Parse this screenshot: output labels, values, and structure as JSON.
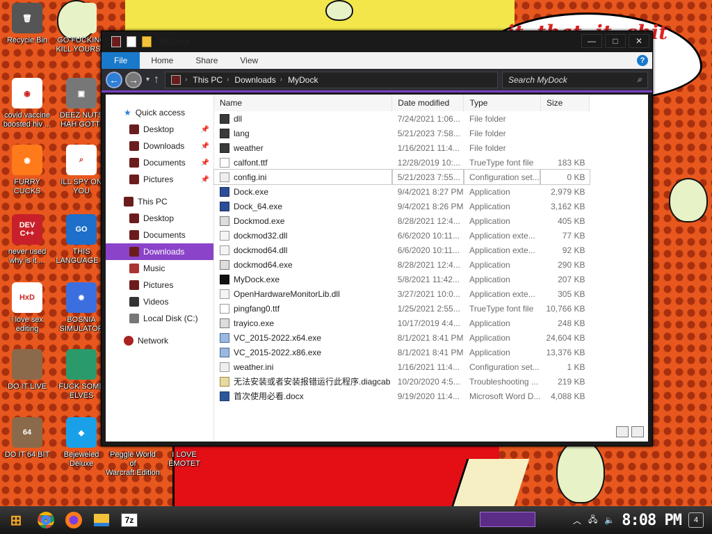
{
  "desktop": {
    "icons": [
      {
        "label": "Recycle Bin",
        "color": "#555555",
        "glyph": "🗑"
      },
      {
        "label": "GO FUCKING\nKILL YOURS...",
        "color": "#e7f2c6",
        "glyph": ""
      },
      {
        "label": "covid vaccine\nboosted hiv ...",
        "color": "#ffffff",
        "glyph": "◉"
      },
      {
        "label": "DEEZ NUTS\nHAH GOTTI",
        "color": "#777777",
        "glyph": "▣"
      },
      {
        "label": "FURRY CUCKS",
        "color": "#ff7a1a",
        "glyph": "◉"
      },
      {
        "label": "ILL SPY ON\nYOU",
        "color": "#ffffff",
        "glyph": "⌕"
      },
      {
        "label": "never used\nwhy is it ...",
        "color": "#c8202a",
        "glyph": "DEV\nC++"
      },
      {
        "label": "THIS\nLANGUAGE ...",
        "color": "#1d6fc9",
        "glyph": "GO"
      },
      {
        "label": "i love sex\nediting",
        "color": "#ffffff",
        "glyph": "HxD"
      },
      {
        "label": "BOSNIA\nSIMULATOR",
        "color": "#3b6fe0",
        "glyph": "✹"
      },
      {
        "label": "DO IT LIVE",
        "color": "#8a6a4a",
        "glyph": ""
      },
      {
        "label": "FUCK SOME\nELVES",
        "color": "#2a9a6a",
        "glyph": ""
      },
      {
        "label": "DO IT 64 BIT",
        "color": "#8a6a4a",
        "glyph": "64"
      },
      {
        "label": "Bejeweled\nDeluxe",
        "color": "#1aa0e8",
        "glyph": "◆"
      },
      {
        "label": "Peggle World of\nWarcraft Edition",
        "color": "",
        "glyph": ""
      },
      {
        "label": "I LOVE EMOTET",
        "color": "",
        "glyph": ""
      }
    ],
    "scrawl": "...it..that..it..chit\nw"
  },
  "window": {
    "title": "MyDock",
    "ribbon_tabs": [
      "File",
      "Home",
      "Share",
      "View"
    ],
    "help": "?",
    "controls": {
      "minimize": "—",
      "maximize": "□",
      "close": "✕"
    },
    "breadcrumb": [
      "This PC",
      "Downloads",
      "MyDock"
    ],
    "search_placeholder": "Search MyDock",
    "nav": {
      "quick_access": "Quick access",
      "quick_items": [
        "Desktop",
        "Downloads",
        "Documents",
        "Pictures"
      ],
      "this_pc": "This PC",
      "pc_items": [
        "Desktop",
        "Documents",
        "Downloads",
        "Music",
        "Pictures",
        "Videos",
        "Local Disk (C:)"
      ],
      "network": "Network",
      "selected": "Downloads"
    },
    "columns": [
      "Name",
      "Date modified",
      "Type",
      "Size"
    ],
    "files": [
      {
        "name": "dll",
        "date": "7/24/2021 1:06...",
        "type": "File folder",
        "size": "",
        "icon": "folder"
      },
      {
        "name": "lang",
        "date": "5/21/2023 7:58...",
        "type": "File folder",
        "size": "",
        "icon": "folder"
      },
      {
        "name": "weather",
        "date": "1/16/2021 11:4...",
        "type": "File folder",
        "size": "",
        "icon": "folder"
      },
      {
        "name": "calfont.ttf",
        "date": "12/28/2019 10:...",
        "type": "TrueType font file",
        "size": "183 KB",
        "icon": "font"
      },
      {
        "name": "config.ini",
        "date": "5/21/2023 7:55...",
        "type": "Configuration set...",
        "size": "0 KB",
        "icon": "config"
      },
      {
        "name": "Dock.exe",
        "date": "9/4/2021 8:27 PM",
        "type": "Application",
        "size": "2,979 KB",
        "icon": "app"
      },
      {
        "name": "Dock_64.exe",
        "date": "9/4/2021 8:26 PM",
        "type": "Application",
        "size": "3,162 KB",
        "icon": "app"
      },
      {
        "name": "Dockmod.exe",
        "date": "8/28/2021 12:4...",
        "type": "Application",
        "size": "405 KB",
        "icon": "tool"
      },
      {
        "name": "dockmod32.dll",
        "date": "6/6/2020 10:11...",
        "type": "Application exte...",
        "size": "77 KB",
        "icon": "dll"
      },
      {
        "name": "dockmod64.dll",
        "date": "6/6/2020 10:11...",
        "type": "Application exte...",
        "size": "92 KB",
        "icon": "dll"
      },
      {
        "name": "dockmod64.exe",
        "date": "8/28/2021 12:4...",
        "type": "Application",
        "size": "290 KB",
        "icon": "tool"
      },
      {
        "name": "MyDock.exe",
        "date": "5/8/2021 11:42...",
        "type": "Application",
        "size": "207 KB",
        "icon": "black"
      },
      {
        "name": "OpenHardwareMonitorLib.dll",
        "date": "3/27/2021 10:0...",
        "type": "Application exte...",
        "size": "305 KB",
        "icon": "dll"
      },
      {
        "name": "pingfang0.ttf",
        "date": "1/25/2021 2:55...",
        "type": "TrueType font file",
        "size": "10,766 KB",
        "icon": "font"
      },
      {
        "name": "trayico.exe",
        "date": "10/17/2019 4:4...",
        "type": "Application",
        "size": "248 KB",
        "icon": "tool"
      },
      {
        "name": "VC_2015-2022.x64.exe",
        "date": "8/1/2021 8:41 PM",
        "type": "Application",
        "size": "24,604 KB",
        "icon": "installer"
      },
      {
        "name": "VC_2015-2022.x86.exe",
        "date": "8/1/2021 8:41 PM",
        "type": "Application",
        "size": "13,376 KB",
        "icon": "installer"
      },
      {
        "name": "weather.ini",
        "date": "1/16/2021 11:4...",
        "type": "Configuration set...",
        "size": "1 KB",
        "icon": "config"
      },
      {
        "name": "无法安装或者安装报错运行此程序.diagcab",
        "date": "10/20/2020 4:5...",
        "type": "Troubleshooting ...",
        "size": "219 KB",
        "icon": "diag"
      },
      {
        "name": "首次使用必看.docx",
        "date": "9/19/2020 11:4...",
        "type": "Microsoft Word D...",
        "size": "4,088 KB",
        "icon": "word"
      }
    ],
    "selected_file": "config.ini"
  },
  "taskbar": {
    "pinned": [
      "Start",
      "Chrome",
      "Firefox",
      "File Explorer",
      "7-Zip"
    ],
    "seven_zip": "7z",
    "clock": "8:08 PM",
    "notifications": "4"
  },
  "colors": {
    "accent": "#8a43c9",
    "file_tab": "#1979ca",
    "folder": "#3a3a3a"
  }
}
